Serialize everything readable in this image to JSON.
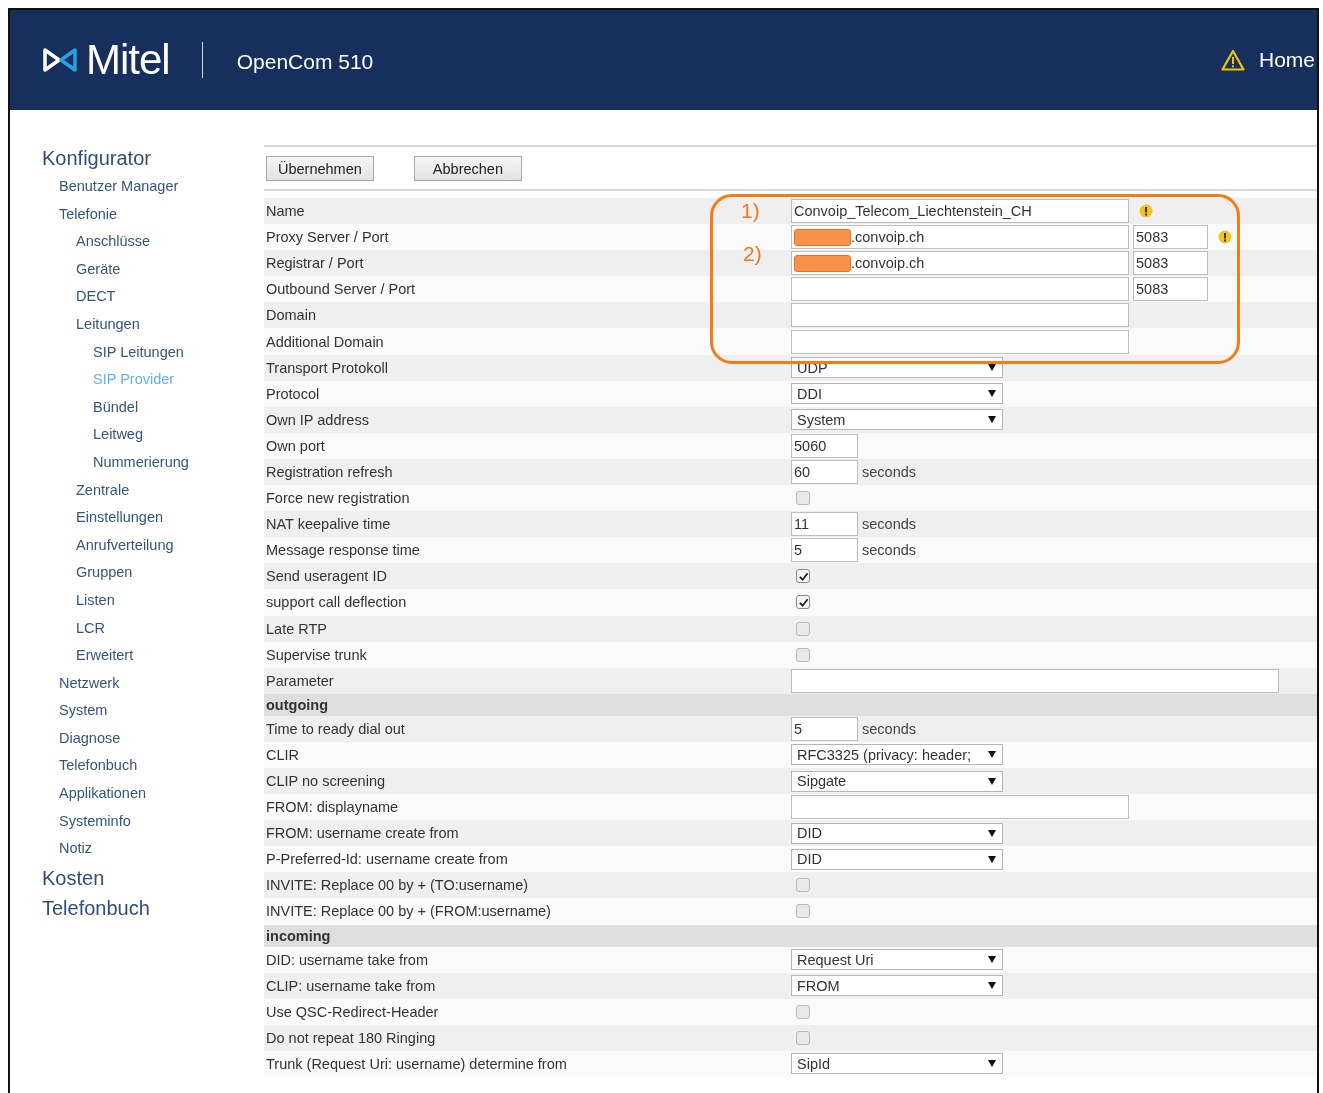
{
  "header": {
    "logo": "Mitel",
    "product": "OpenCom 510",
    "home": "Home"
  },
  "sidebar": {
    "items": [
      {
        "label": "Konfigurator",
        "selected": false,
        "children": [
          {
            "label": "Benutzer Manager",
            "selected": false
          },
          {
            "label": "Telefonie",
            "selected": false,
            "children": [
              {
                "label": "Anschlüsse",
                "selected": false
              },
              {
                "label": "Geräte",
                "selected": false
              },
              {
                "label": "DECT",
                "selected": false
              },
              {
                "label": "Leitungen",
                "selected": false,
                "children": [
                  {
                    "label": "SIP Leitungen",
                    "selected": false
                  },
                  {
                    "label": "SIP Provider",
                    "selected": true
                  },
                  {
                    "label": "Bündel",
                    "selected": false
                  },
                  {
                    "label": "Leitweg",
                    "selected": false
                  },
                  {
                    "label": "Nummerierung",
                    "selected": false
                  }
                ]
              },
              {
                "label": "Zentrale",
                "selected": false
              },
              {
                "label": "Einstellungen",
                "selected": false
              },
              {
                "label": "Anrufverteilung",
                "selected": false
              },
              {
                "label": "Gruppen",
                "selected": false
              },
              {
                "label": "Listen",
                "selected": false
              },
              {
                "label": "LCR",
                "selected": false
              },
              {
                "label": "Erweitert",
                "selected": false
              }
            ]
          },
          {
            "label": "Netzwerk",
            "selected": false
          },
          {
            "label": "System",
            "selected": false
          },
          {
            "label": "Diagnose",
            "selected": false
          },
          {
            "label": "Telefonbuch",
            "selected": false
          },
          {
            "label": "Applikationen",
            "selected": false
          },
          {
            "label": "Systeminfo",
            "selected": false
          },
          {
            "label": "Notiz",
            "selected": false
          }
        ]
      },
      {
        "label": "Kosten",
        "selected": false
      },
      {
        "label": "Telefonbuch",
        "selected": false
      }
    ]
  },
  "buttons": [
    "Übernehmen",
    "Abbrechen"
  ],
  "annotation": {
    "labels": [
      "1)",
      "2)"
    ]
  },
  "rows": [
    {
      "kind": "text",
      "label": "Name",
      "value": "Convoip_Telecom_Liechtenstein_CH",
      "warning": true
    },
    {
      "kind": "host_port",
      "label": "Proxy Server / Port",
      "value": ".convoip.ch",
      "redacted": true,
      "port": "5083",
      "warning": true
    },
    {
      "kind": "host_port",
      "label": "Registrar / Port",
      "value": ".convoip.ch",
      "redacted": true,
      "port": "5083",
      "warning": false
    },
    {
      "kind": "host_port",
      "label": "Outbound Server / Port",
      "value": "",
      "redacted": false,
      "port": "5083",
      "warning": false
    },
    {
      "kind": "text",
      "label": "Domain",
      "value": ""
    },
    {
      "kind": "text",
      "label": "Additional Domain",
      "value": ""
    },
    {
      "kind": "select",
      "label": "Transport Protokoll",
      "value": "UDP"
    },
    {
      "kind": "select",
      "label": "Protocol",
      "value": "DDI"
    },
    {
      "kind": "select",
      "label": "Own IP address",
      "value": "System"
    },
    {
      "kind": "number",
      "label": "Own port",
      "value": "5060"
    },
    {
      "kind": "number",
      "label": "Registration refresh",
      "value": "60",
      "unit": "seconds"
    },
    {
      "kind": "checkbox",
      "label": "Force new registration",
      "checked": false
    },
    {
      "kind": "number",
      "label": "NAT keepalive time",
      "value": "11",
      "unit": "seconds"
    },
    {
      "kind": "number",
      "label": "Message response time",
      "value": "5",
      "unit": "seconds"
    },
    {
      "kind": "checkbox",
      "label": "Send useragent ID",
      "checked": true
    },
    {
      "kind": "checkbox",
      "label": "support call deflection",
      "checked": true
    },
    {
      "kind": "checkbox",
      "label": "Late RTP",
      "checked": false
    },
    {
      "kind": "checkbox",
      "label": "Supervise trunk",
      "checked": false
    },
    {
      "kind": "long_text",
      "label": "Parameter",
      "value": ""
    },
    {
      "kind": "heading",
      "label": "outgoing"
    },
    {
      "kind": "number",
      "label": "Time to ready dial out",
      "value": "5",
      "unit": "seconds"
    },
    {
      "kind": "select",
      "label": "CLIR",
      "value": "RFC3325 (privacy: header;"
    },
    {
      "kind": "select",
      "label": "CLIP no screening",
      "value": "Sipgate"
    },
    {
      "kind": "text",
      "label": "FROM: displayname",
      "value": ""
    },
    {
      "kind": "select",
      "label": "FROM: username create from",
      "value": "DID"
    },
    {
      "kind": "select",
      "label": "P-Preferred-Id: username create from",
      "value": "DID"
    },
    {
      "kind": "checkbox",
      "label": "INVITE: Replace 00 by + (TO:username)",
      "checked": false
    },
    {
      "kind": "checkbox",
      "label": "INVITE: Replace 00 by + (FROM:username)",
      "checked": false
    },
    {
      "kind": "heading",
      "label": "incoming"
    },
    {
      "kind": "select",
      "label": "DID: username take from",
      "value": "Request Uri"
    },
    {
      "kind": "select",
      "label": "CLIP: username take from",
      "value": "FROM"
    },
    {
      "kind": "checkbox",
      "label": "Use QSC-Redirect-Header",
      "checked": false
    },
    {
      "kind": "checkbox",
      "label": "Do not repeat 180 Ringing",
      "checked": false
    },
    {
      "kind": "select",
      "label": "Trunk (Request Uri: username) determine from",
      "value": "SipId"
    }
  ]
}
